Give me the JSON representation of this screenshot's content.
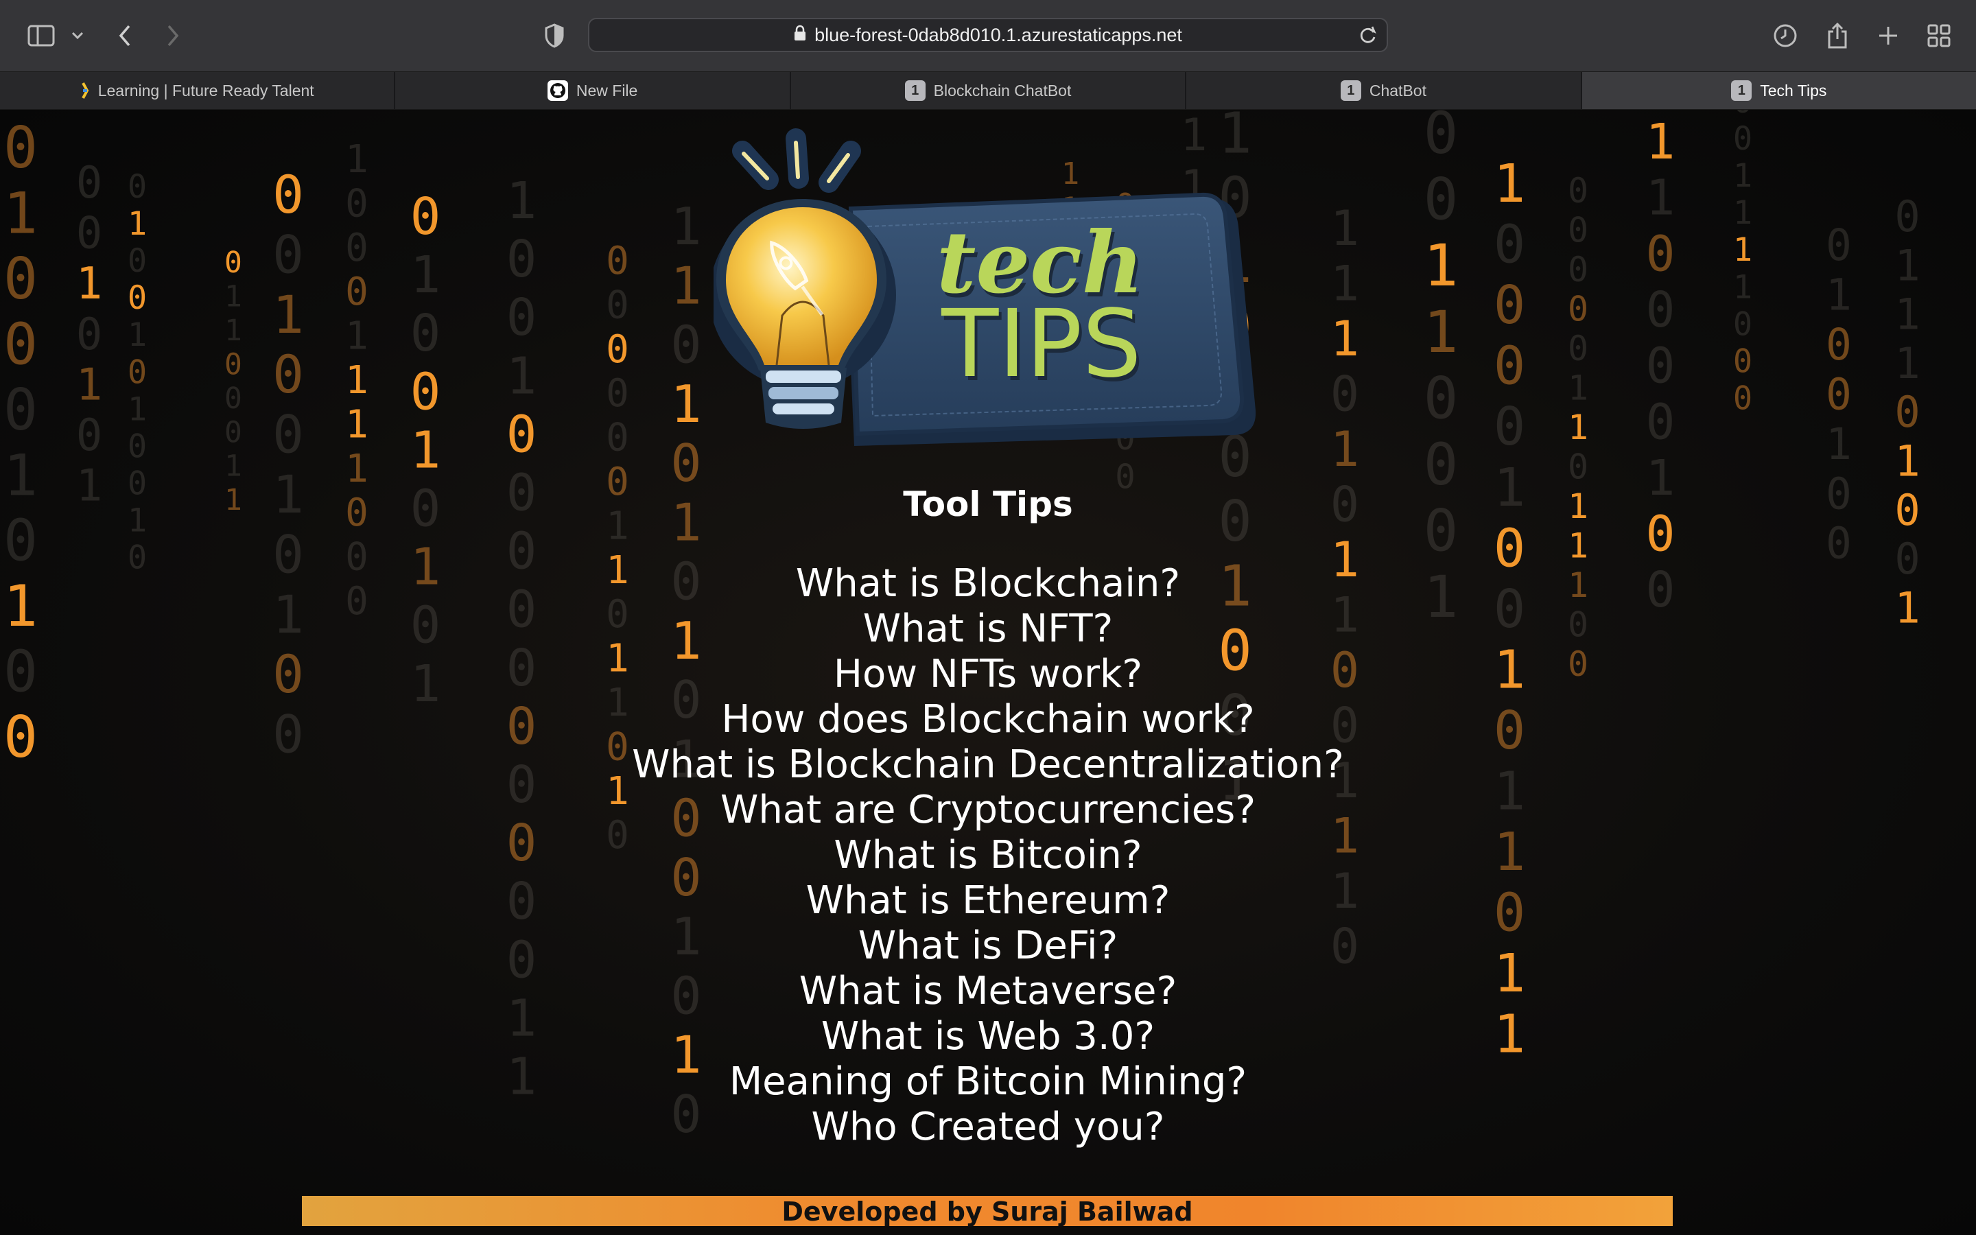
{
  "browser": {
    "url": "blue-forest-0dab8d010.1.azurestaticapps.net",
    "tabs": [
      {
        "label": "Learning | Future Ready Talent",
        "icon": "learning-favicon-icon",
        "active": false
      },
      {
        "label": "New File",
        "icon": "github-icon",
        "active": false
      },
      {
        "label": "Blockchain ChatBot",
        "icon": "1",
        "active": false
      },
      {
        "label": "ChatBot",
        "icon": "1",
        "active": false
      },
      {
        "label": "Tech Tips",
        "icon": "1",
        "active": true
      }
    ]
  },
  "logo": {
    "line1": "tech",
    "line2": "TIPS"
  },
  "page": {
    "title": "Tool Tips",
    "links": [
      "What is Blockchain?",
      "What is NFT?",
      "How NFTs work?",
      "How does Blockchain work?",
      "What is Blockchain Decentralization?",
      "What are Cryptocurrencies?",
      "What is Bitcoin?",
      "What is Ethereum?",
      "What is DeFi?",
      "What is Metaverse?",
      "What is Web 3.0?",
      "Meaning of Bitcoin Mining?",
      "Who Created you?"
    ],
    "footer": "Developed by Suraj Bailwad"
  },
  "colors": {
    "accent_orange": "#f08a2e",
    "logo_green": "#b9d65a",
    "logo_panel": "#2e4766",
    "bulb_yellow": "#f7c94a"
  }
}
